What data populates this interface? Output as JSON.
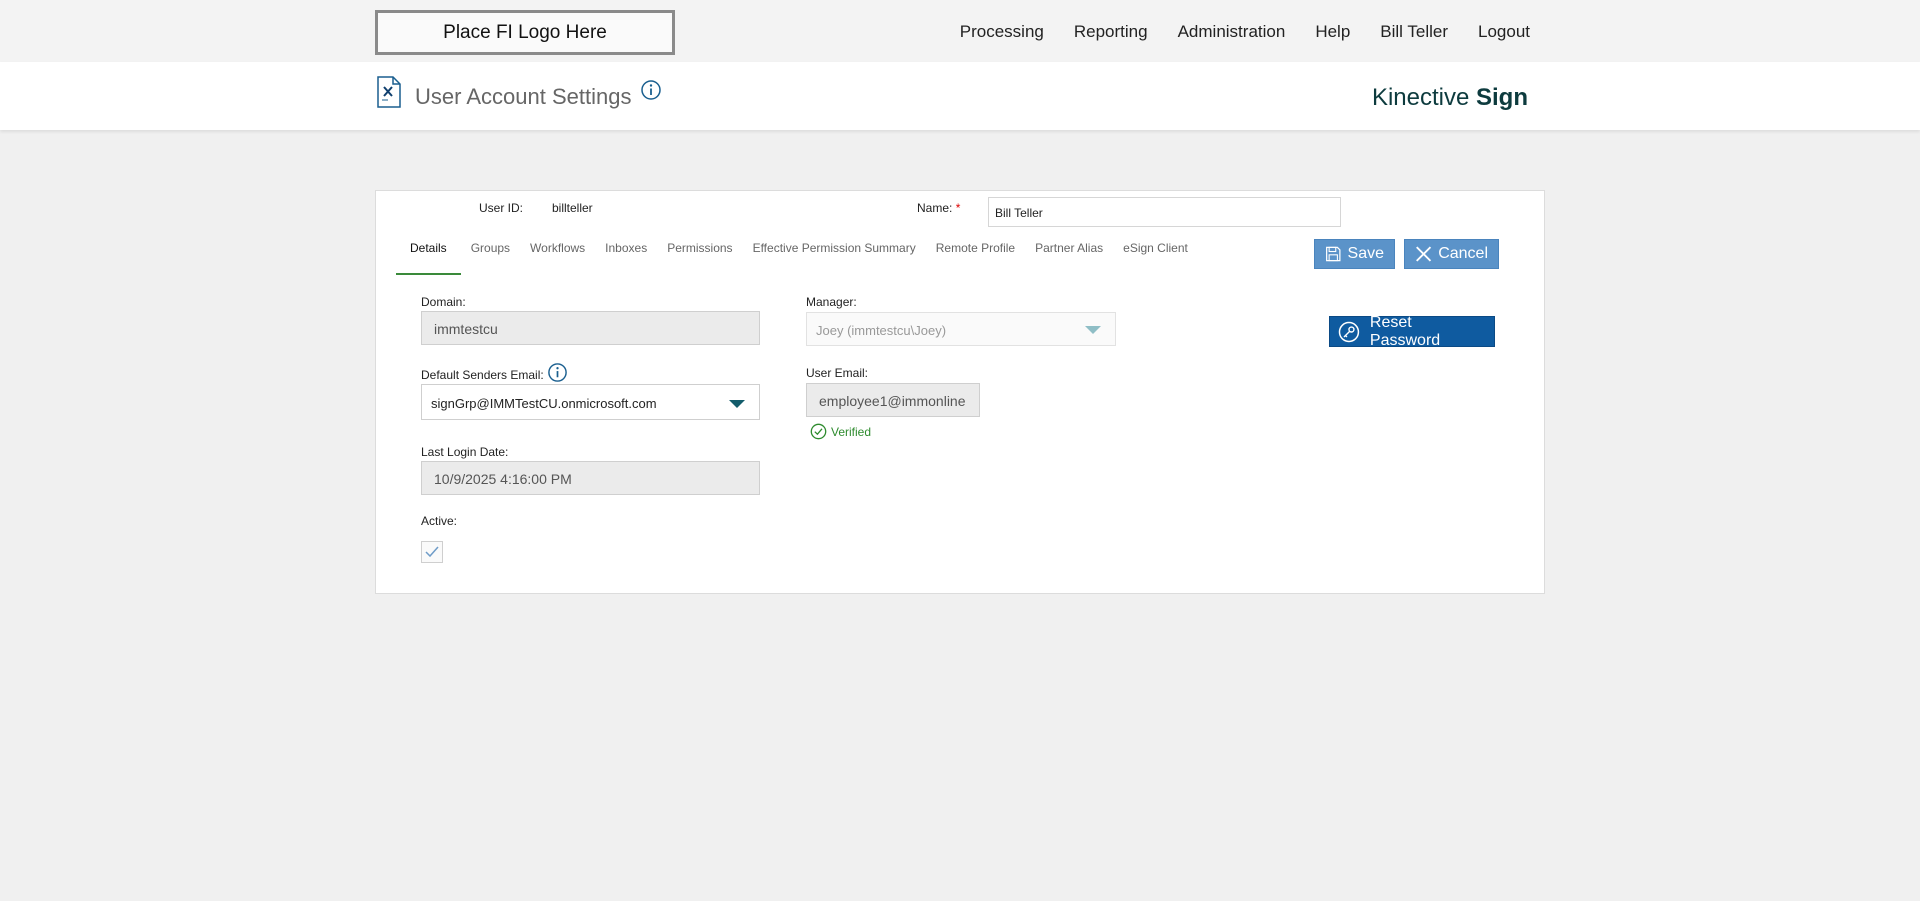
{
  "header": {
    "logo_text": "Place FI Logo Here",
    "nav": [
      "Processing",
      "Reporting",
      "Administration",
      "Help",
      "Bill Teller",
      "Logout"
    ]
  },
  "titlebar": {
    "title": "User Account Settings",
    "brand_light": "Kinective ",
    "brand_bold": "Sign"
  },
  "form": {
    "user_id_label": "User ID:",
    "user_id_value": "billteller",
    "name_label": "Name:",
    "name_required": "*",
    "name_value": "Bill Teller",
    "tabs": [
      "Details",
      "Groups",
      "Workflows",
      "Inboxes",
      "Permissions",
      "Effective Permission Summary",
      "Remote Profile",
      "Partner Alias",
      "eSign Client"
    ],
    "active_tab": "Details",
    "save_label": "Save",
    "cancel_label": "Cancel",
    "reset_password_label": "Reset Password",
    "domain_label": "Domain:",
    "domain_value": "immtestcu",
    "default_senders_email_label": "Default Senders Email:",
    "default_senders_email_value": "signGrp@IMMTestCU.onmicrosoft.com",
    "last_login_label": "Last Login Date:",
    "last_login_value": "10/9/2025 4:16:00 PM",
    "active_label": "Active:",
    "active_checked": true,
    "manager_label": "Manager:",
    "manager_value": "Joey (immtestcu\\Joey)",
    "user_email_label": "User Email:",
    "user_email_value": "employee1@immonline",
    "verified_label": "Verified"
  },
  "colors": {
    "accent_blue": "#0f5ba0",
    "light_blue_button": "#5b93c9",
    "tab_underline": "#3a8a3a",
    "verified_green": "#2e8b2e",
    "brand_text": "#0d3b3e"
  }
}
